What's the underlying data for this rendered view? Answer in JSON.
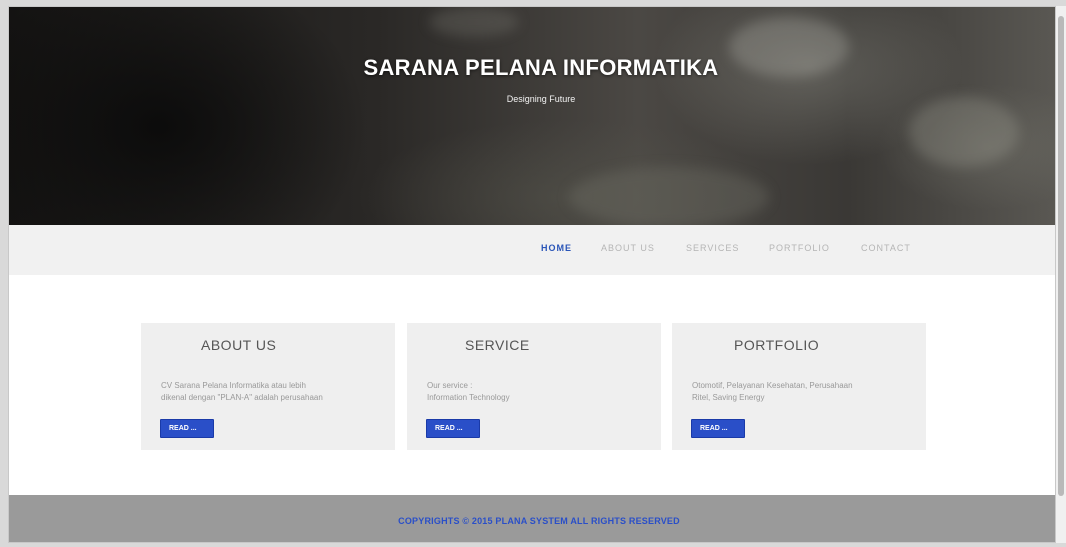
{
  "hero": {
    "title": "SARANA PELANA INFORMATIKA",
    "subtitle": "Designing Future"
  },
  "nav": {
    "items": [
      {
        "label": "HOME",
        "active": true
      },
      {
        "label": "ABOUT US",
        "active": false
      },
      {
        "label": "SERVICES",
        "active": false
      },
      {
        "label": "PORTFOLIO",
        "active": false
      },
      {
        "label": "CONTACT",
        "active": false
      }
    ]
  },
  "cards": [
    {
      "title": "ABOUT US",
      "lines": [
        "CV Sarana Pelana Informatika atau lebih",
        "dikenal dengan \"PLAN-A\" adalah perusahaan"
      ],
      "button": "READ ..."
    },
    {
      "title": "SERVICE",
      "lines": [
        "Our service :",
        "Information Technology"
      ],
      "button": "READ ..."
    },
    {
      "title": "PORTFOLIO",
      "lines": [
        "Otomotif, Pelayanan Kesehatan, Perusahaan",
        "Ritel, Saving Energy"
      ],
      "button": "READ ..."
    }
  ],
  "footer": {
    "text": "COPYRIGHTS © 2015 PLANA SYSTEM ALL RIGHTS RESERVED"
  },
  "colors": {
    "accent": "#2a4fc8",
    "nav_active": "#2a55b8",
    "nav_bar": "#f1f1f1",
    "card_bg": "#efefef",
    "footer_bg": "#9a9a9a"
  }
}
